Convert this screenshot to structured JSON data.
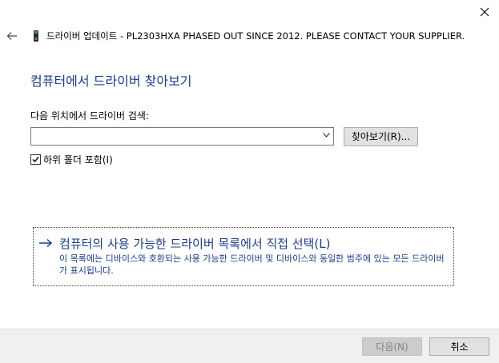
{
  "window": {
    "close_icon": "close-icon",
    "back_icon": "back-arrow-icon"
  },
  "header": {
    "device_icon": "device-icon",
    "title": "드라이버 업데이트 - PL2303HXA PHASED OUT SINCE 2012. PLEASE CONTACT YOUR SUPPLIER."
  },
  "page": {
    "title": "컴퓨터에서 드라이버 찾아보기",
    "search_label": "다음 위치에서 드라이버 검색:",
    "path_value": "",
    "browse_button": "찾아보기(R)...",
    "include_subfolders_label": "하위 폴더 포함(I)",
    "include_subfolders_checked": true
  },
  "pick_from_list": {
    "icon": "arrow-right-icon",
    "title": "컴퓨터의 사용 가능한 드라이버 목록에서 직접 선택(L)",
    "description": "이 목록에는 디바이스와 호환되는 사용 가능한 드라이버 및 디바이스와 동일한 범주에 있는 모든 드라이버가 표시됩니다."
  },
  "footer": {
    "next_button": "다음(N)",
    "next_enabled": false,
    "cancel_button": "취소"
  },
  "colors": {
    "accent": "#1a3d8f",
    "footer_bg": "#f0f0f0",
    "button_bg": "#e1e1e1",
    "disabled_text": "#838383"
  }
}
